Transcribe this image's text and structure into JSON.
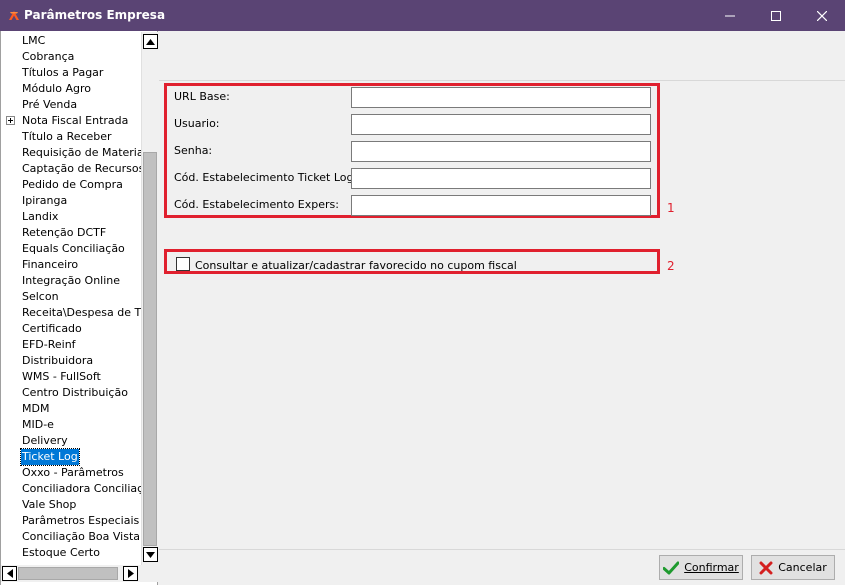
{
  "window": {
    "title": "Parâmetros Empresa"
  },
  "titlebar_buttons": {
    "minimize_icon": "minimize-icon",
    "maximize_icon": "maximize-icon",
    "close_icon": "close-icon"
  },
  "tree": {
    "items": [
      {
        "label": "LMC"
      },
      {
        "label": "Cobrança"
      },
      {
        "label": "Títulos a Pagar"
      },
      {
        "label": "Módulo Agro"
      },
      {
        "label": "Pré Venda"
      },
      {
        "label": "Nota Fiscal Entrada",
        "expandable": true
      },
      {
        "label": "Título a Receber"
      },
      {
        "label": "Requisição de Materiais"
      },
      {
        "label": "Captação de Recursos"
      },
      {
        "label": "Pedido de Compra"
      },
      {
        "label": "Ipiranga"
      },
      {
        "label": "Landix"
      },
      {
        "label": "Retenção DCTF"
      },
      {
        "label": "Equals Conciliação"
      },
      {
        "label": "Financeiro"
      },
      {
        "label": "Integração Online"
      },
      {
        "label": "Selcon"
      },
      {
        "label": "Receita\\Despesa de Títul"
      },
      {
        "label": "Certificado"
      },
      {
        "label": "EFD-Reinf"
      },
      {
        "label": "Distribuidora"
      },
      {
        "label": "WMS - FullSoft"
      },
      {
        "label": "Centro Distribuição"
      },
      {
        "label": "MDM"
      },
      {
        "label": "MID-e"
      },
      {
        "label": "Delivery"
      },
      {
        "label": "Ticket Log",
        "selected": true
      },
      {
        "label": "Oxxo - Parâmetros"
      },
      {
        "label": "Conciliadora Conciliação"
      },
      {
        "label": "Vale Shop"
      },
      {
        "label": "Parâmetros Especiais"
      },
      {
        "label": "Conciliação Boa Vista"
      },
      {
        "label": "Estoque Certo"
      }
    ]
  },
  "form": {
    "fields": [
      {
        "label": "URL Base:",
        "value": ""
      },
      {
        "label": "Usuario:",
        "value": ""
      },
      {
        "label": "Senha:",
        "value": ""
      },
      {
        "label": "Cód. Estabelecimento Ticket Log:",
        "value": ""
      },
      {
        "label": "Cód. Estabelecimento Expers:",
        "value": ""
      }
    ],
    "marker1": "1",
    "checkbox_label": "Consultar e atualizar/cadastrar favorecido no cupom fiscal",
    "checkbox_checked": false,
    "marker2": "2"
  },
  "buttons": {
    "confirm": "Confirmar",
    "cancel": "Cancelar"
  },
  "colors": {
    "titlebar": "#5a4474",
    "highlight": "#e0202e",
    "selection": "#0078d7"
  }
}
